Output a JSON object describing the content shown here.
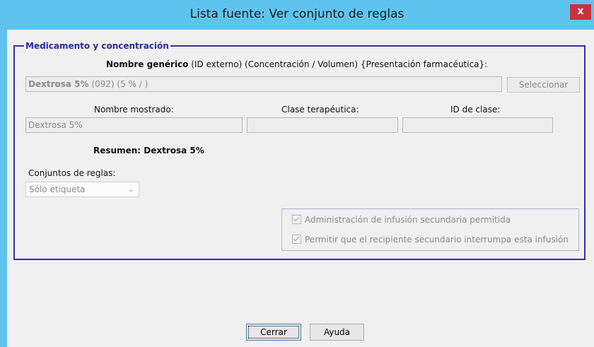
{
  "window": {
    "title": "Lista fuente: Ver conjunto de reglas",
    "close_glyph": "x"
  },
  "group": {
    "title": "Medicamento y concentración",
    "header_bold": "Nombre genérico",
    "header_rest": " (ID externo) (Concentración / Volumen) {Presentación farmacéutica}:",
    "drug_name_bold": "Dextrosa 5%",
    "drug_name_rest": " (092) (5 % / )",
    "select_button": "Seleccionar",
    "display_name_label": "Nombre mostrado:",
    "display_name_value": "Dextrosa 5%",
    "therapeutic_class_label": "Clase terapéutica:",
    "therapeutic_class_value": "",
    "class_id_label": "ID de clase:",
    "class_id_value": "",
    "summary": "Resumen: Dextrosa 5%",
    "rule_sets_label": "Conjuntos de reglas:",
    "rule_sets_selected": "Sólo etiqueta",
    "options": [
      {
        "label": "Administración de infusión secundaria permitida",
        "checked": true
      },
      {
        "label": "Permitir que el recipiente secundario interrumpa esta infusión",
        "checked": true
      }
    ]
  },
  "buttons": {
    "close": "Cerrar",
    "help": "Ayuda"
  },
  "colors": {
    "titlebar": "#5ec4ef",
    "close_button": "#c7333d",
    "group_border": "#3030a0"
  }
}
